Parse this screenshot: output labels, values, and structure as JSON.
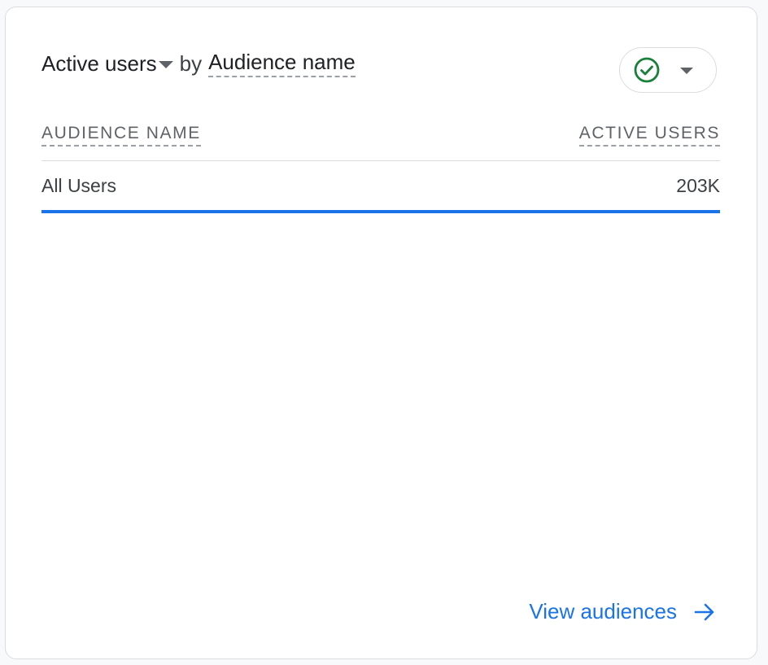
{
  "card": {
    "title": {
      "metric": "Active users",
      "by": "by",
      "dimension": "Audience name"
    },
    "compare_icon": "check-circle-icon",
    "compare_color": "#188038",
    "table": {
      "columns": [
        "AUDIENCE NAME",
        "ACTIVE USERS"
      ],
      "rows": [
        {
          "audience": "All Users",
          "active_users": "203K"
        }
      ]
    },
    "link": {
      "label": "View audiences",
      "icon": "arrow-right-icon"
    },
    "accent_color": "#1a73e8"
  }
}
